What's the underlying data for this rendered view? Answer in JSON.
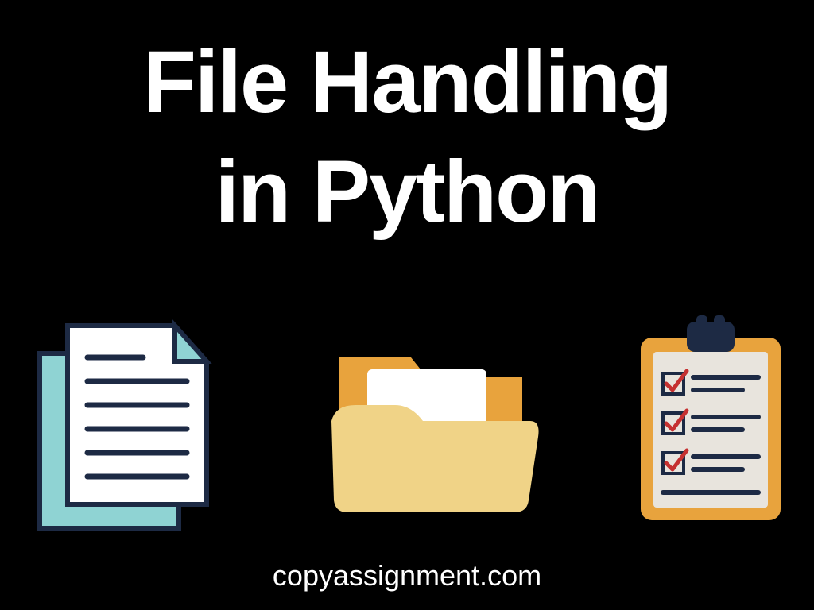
{
  "title_line1": "File Handling",
  "title_line2": "in Python",
  "footer": "copyassignment.com",
  "icons": {
    "document": "document-stack-icon",
    "folder": "folder-icon",
    "clipboard": "clipboard-checklist-icon"
  },
  "colors": {
    "background": "#000000",
    "text": "#ffffff",
    "teal": "#8fd3d3",
    "orange": "#e8a33d",
    "folder_light": "#f0d387",
    "clipboard_paper": "#e8e4dd",
    "navy": "#1d2a44",
    "red": "#c53030"
  }
}
